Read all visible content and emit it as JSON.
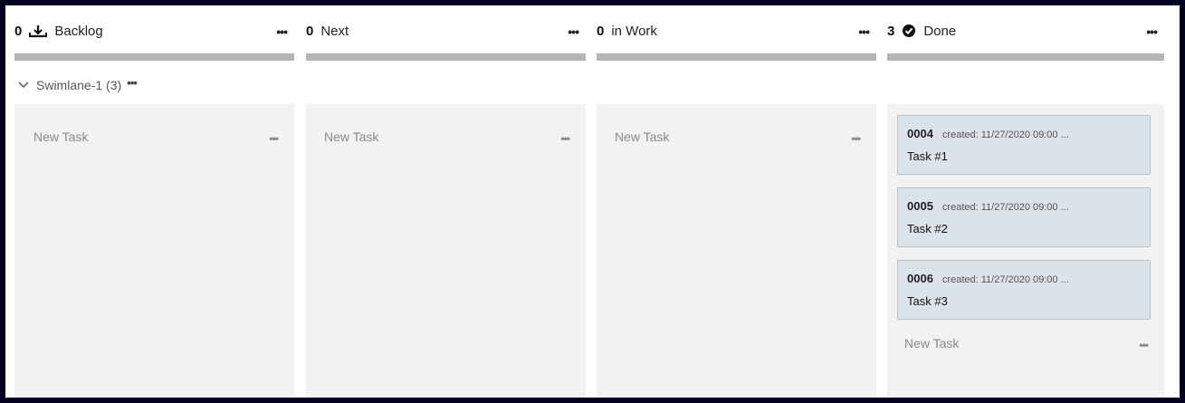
{
  "columns": [
    {
      "count": "0",
      "title": "Backlog",
      "more": "•••",
      "icon": "download-tray-icon"
    },
    {
      "count": "0",
      "title": "Next",
      "more": "•••"
    },
    {
      "count": "0",
      "title": "in Work",
      "more": "•••"
    },
    {
      "count": "3",
      "title": "Done",
      "more": "•••",
      "icon": "check-circle-icon"
    }
  ],
  "swimlane": {
    "label": "Swimlane-1 (3)",
    "more": "•••"
  },
  "lanes": [
    {
      "new_task": "New Task",
      "more": "•••"
    },
    {
      "new_task": "New Task",
      "more": "•••"
    },
    {
      "new_task": "New Task",
      "more": "•••"
    },
    {
      "new_task": "New Task",
      "more": "•••"
    }
  ],
  "cards": [
    {
      "id": "0004",
      "created": "created: 11/27/2020 09:00 ...",
      "name": "Task #1"
    },
    {
      "id": "0005",
      "created": "created: 11/27/2020 09:00 ...",
      "name": "Task #2"
    },
    {
      "id": "0006",
      "created": "created: 11/27/2020 09:00 ...",
      "name": "Task #3"
    }
  ],
  "colors": {
    "background": "#000021",
    "lane": "#f2f2f2",
    "card": "#dde3ea",
    "bar": "#b5b5b5"
  }
}
